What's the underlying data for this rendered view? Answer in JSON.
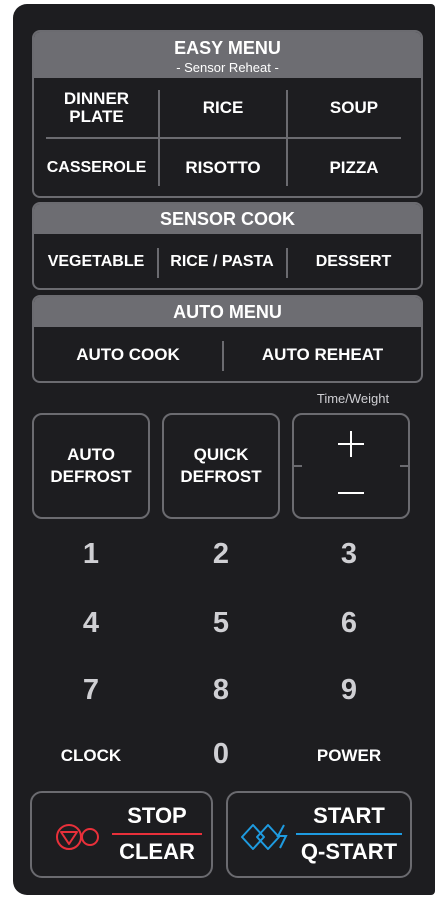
{
  "easy_menu": {
    "title": "EASY MENU",
    "subtitle": "- Sensor Reheat -",
    "row1": [
      "DINNER PLATE",
      "RICE",
      "SOUP"
    ],
    "row2": [
      "CASSEROLE",
      "RISOTTO",
      "PIZZA"
    ]
  },
  "sensor_cook": {
    "title": "SENSOR COOK",
    "items": [
      "VEGETABLE",
      "RICE / PASTA",
      "DESSERT"
    ]
  },
  "auto_menu": {
    "title": "AUTO MENU",
    "items": [
      "AUTO COOK",
      "AUTO REHEAT"
    ]
  },
  "time_weight": {
    "label": "Time/Weight",
    "plus": "+",
    "minus": "—"
  },
  "defrost": {
    "auto_line1": "AUTO",
    "auto_line2": "DEFROST",
    "quick_line1": "QUICK",
    "quick_line2": "DEFROST"
  },
  "keypad": {
    "digits": [
      "1",
      "2",
      "3",
      "4",
      "5",
      "6",
      "7",
      "8",
      "9"
    ],
    "clock": "CLOCK",
    "zero": "0",
    "power": "POWER"
  },
  "stop": {
    "line1": "STOP",
    "line2": "CLEAR",
    "icon": "stop-icon",
    "color": "#e8303a"
  },
  "start": {
    "line1": "START",
    "line2": "Q-START",
    "icon": "start-icon",
    "color": "#1e9be0"
  },
  "colors": {
    "panel": "#1d1d20",
    "header": "#6d6d72",
    "border": "#6b6b70"
  }
}
